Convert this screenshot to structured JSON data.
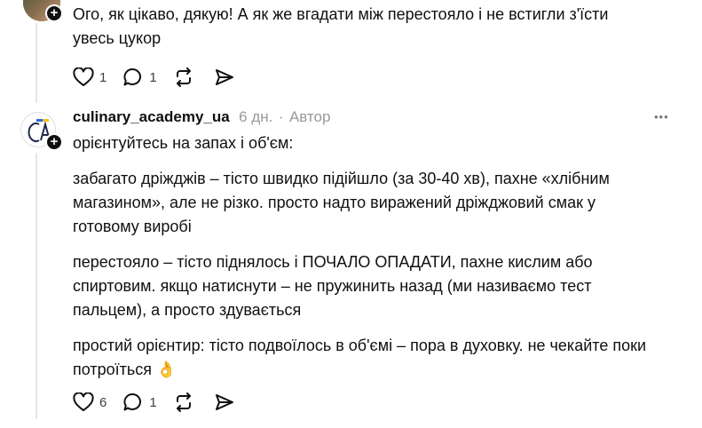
{
  "comment_top": {
    "text_line1": "Ого, як цікаво, дякую! А як же вгадати між перестояло і не встигли з'їсти",
    "text_line2": "увесь цукор",
    "likes": "1",
    "replies": "1"
  },
  "comment_author": {
    "username": "culinary_academy_ua",
    "time": "6 дн.",
    "separator": "·",
    "badge": "Автор",
    "more_glyph": "•••",
    "avatar_logo": "CA",
    "paragraphs": [
      {
        "lines": [
          "орієнтуйтесь на запах і об'єм:"
        ]
      },
      {
        "lines": [
          "забагато дріжджів – тісто швидко підійшло (за 30-40 хв), пахне «хлібним",
          "магазином», але не різко. просто надто виражений дріжджовий смак у",
          "готовому виробі"
        ]
      },
      {
        "lines": [
          "перестояло – тісто піднялось і ПОЧАЛО ОПАДАТИ, пахне кислим або",
          "спиртовим. якщо натиснути – не пружинить назад (ми називаємо тест",
          "пальцем), а просто здувається"
        ]
      },
      {
        "lines": [
          "простий орієнтир: тісто подвоїлось в об'ємі – пора в духовку. не чекайте поки",
          "потроїться 👌"
        ]
      }
    ],
    "likes": "6",
    "replies": "1"
  },
  "plus_glyph": "+"
}
